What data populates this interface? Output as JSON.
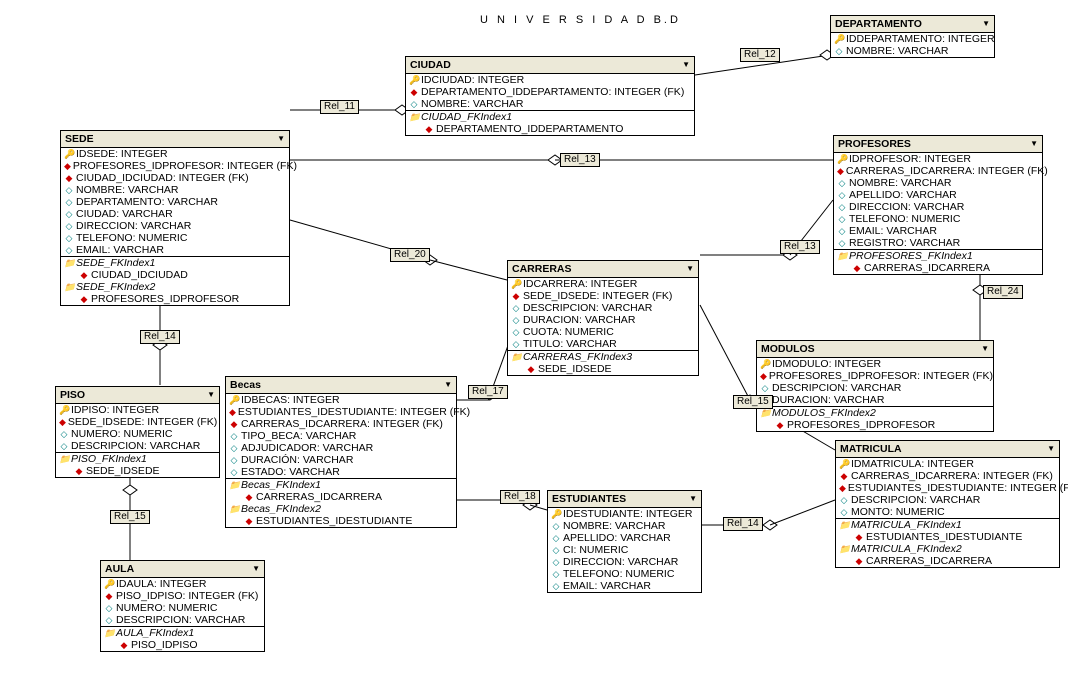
{
  "title": "U N I V E R S I D A D   B.D",
  "rels": {
    "r11": "Rel_11",
    "r12": "Rel_12",
    "r13a": "Rel_13",
    "r13b": "Rel_13",
    "r14a": "Rel_14",
    "r14b": "Rel_14",
    "r15a": "Rel_15",
    "r15b": "Rel_15",
    "r17": "Rel_17",
    "r18": "Rel_18",
    "r20": "Rel_20",
    "r24": "Rel_24"
  },
  "departamento": {
    "name": "DEPARTAMENTO",
    "f1": "IDDEPARTAMENTO: INTEGER",
    "f2": "NOMBRE: VARCHAR"
  },
  "ciudad": {
    "name": "CIUDAD",
    "f1": "IDCIUDAD: INTEGER",
    "f2": "DEPARTAMENTO_IDDEPARTAMENTO: INTEGER (FK)",
    "f3": "NOMBRE: VARCHAR",
    "idx": "CIUDAD_FKIndex1",
    "idxf": "DEPARTAMENTO_IDDEPARTAMENTO"
  },
  "sede": {
    "name": "SEDE",
    "f1": "IDSEDE: INTEGER",
    "f2": "PROFESORES_IDPROFESOR: INTEGER (FK)",
    "f3": "CIUDAD_IDCIUDAD: INTEGER (FK)",
    "f4": "NOMBRE: VARCHAR",
    "f5": "DEPARTAMENTO: VARCHAR",
    "f6": "CIUDAD: VARCHAR",
    "f7": "DIRECCION: VARCHAR",
    "f8": "TELEFONO: NUMERIC",
    "f9": "EMAIL: VARCHAR",
    "idx1": "SEDE_FKIndex1",
    "idx1f": "CIUDAD_IDCIUDAD",
    "idx2": "SEDE_FKIndex2",
    "idx2f": "PROFESORES_IDPROFESOR"
  },
  "profesores": {
    "name": "PROFESORES",
    "f1": "IDPROFESOR: INTEGER",
    "f2": "CARRERAS_IDCARRERA: INTEGER (FK)",
    "f3": "NOMBRE: VARCHAR",
    "f4": "APELLIDO: VARCHAR",
    "f5": "DIRECCION: VARCHAR",
    "f6": "TELEFONO: NUMERIC",
    "f7": "EMAIL: VARCHAR",
    "f8": "REGISTRO: VARCHAR",
    "idx": "PROFESORES_FKIndex1",
    "idxf": "CARRERAS_IDCARRERA"
  },
  "carreras": {
    "name": "CARRERAS",
    "f1": "IDCARRERA: INTEGER",
    "f2": "SEDE_IDSEDE: INTEGER (FK)",
    "f3": "DESCRIPCION: VARCHAR",
    "f4": "DURACION: VARCHAR",
    "f5": "CUOTA: NUMERIC",
    "f6": "TITULO: VARCHAR",
    "idx": "CARRERAS_FKIndex3",
    "idxf": "SEDE_IDSEDE"
  },
  "modulos": {
    "name": "MODULOS",
    "f1": "IDMODULO: INTEGER",
    "f2": "PROFESORES_IDPROFESOR: INTEGER (FK)",
    "f3": "DESCRIPCION: VARCHAR",
    "f4": "DURACION: VARCHAR",
    "idx": "MODULOS_FKIndex2",
    "idxf": "PROFESORES_IDPROFESOR"
  },
  "piso": {
    "name": "PISO",
    "f1": "IDPISO: INTEGER",
    "f2": "SEDE_IDSEDE: INTEGER (FK)",
    "f3": "NUMERO: NUMERIC",
    "f4": "DESCRIPCION: VARCHAR",
    "idx": "PISO_FKIndex1",
    "idxf": "SEDE_IDSEDE"
  },
  "becas": {
    "name": "Becas",
    "f1": "IDBECAS: INTEGER",
    "f2": "ESTUDIANTES_IDESTUDIANTE: INTEGER (FK)",
    "f3": "CARRERAS_IDCARRERA: INTEGER (FK)",
    "f4": "TIPO_BECA: VARCHAR",
    "f5": "ADJUDICADOR: VARCHAR",
    "f6": "DURACIÓN: VARCHAR",
    "f7": "ESTADO: VARCHAR",
    "idx1": "Becas_FKIndex1",
    "idx1f": "CARRERAS_IDCARRERA",
    "idx2": "Becas_FKIndex2",
    "idx2f": "ESTUDIANTES_IDESTUDIANTE"
  },
  "aula": {
    "name": "AULA",
    "f1": "IDAULA: INTEGER",
    "f2": "PISO_IDPISO: INTEGER (FK)",
    "f3": "NUMERO: NUMERIC",
    "f4": "DESCRIPCION: VARCHAR",
    "idx": "AULA_FKIndex1",
    "idxf": "PISO_IDPISO"
  },
  "estudiantes": {
    "name": "ESTUDIANTES",
    "f1": "IDESTUDIANTE: INTEGER",
    "f2": "NOMBRE: VARCHAR",
    "f3": "APELLIDO: VARCHAR",
    "f4": "CI: NUMERIC",
    "f5": "DIRECCION: VARCHAR",
    "f6": "TELEFONO: NUMERIC",
    "f7": "EMAIL: VARCHAR"
  },
  "matricula": {
    "name": "MATRICULA",
    "f1": "IDMATRICULA: INTEGER",
    "f2": "CARRERAS_IDCARRERA: INTEGER (FK)",
    "f3": "ESTUDIANTES_IDESTUDIANTE: INTEGER (FK)",
    "f4": "DESCRIPCION: VARCHAR",
    "f5": "MONTO: NUMERIC",
    "idx1": "MATRICULA_FKIndex1",
    "idx1f": "ESTUDIANTES_IDESTUDIANTE",
    "idx2": "MATRICULA_FKIndex2",
    "idx2f": "CARRERAS_IDCARRERA"
  }
}
